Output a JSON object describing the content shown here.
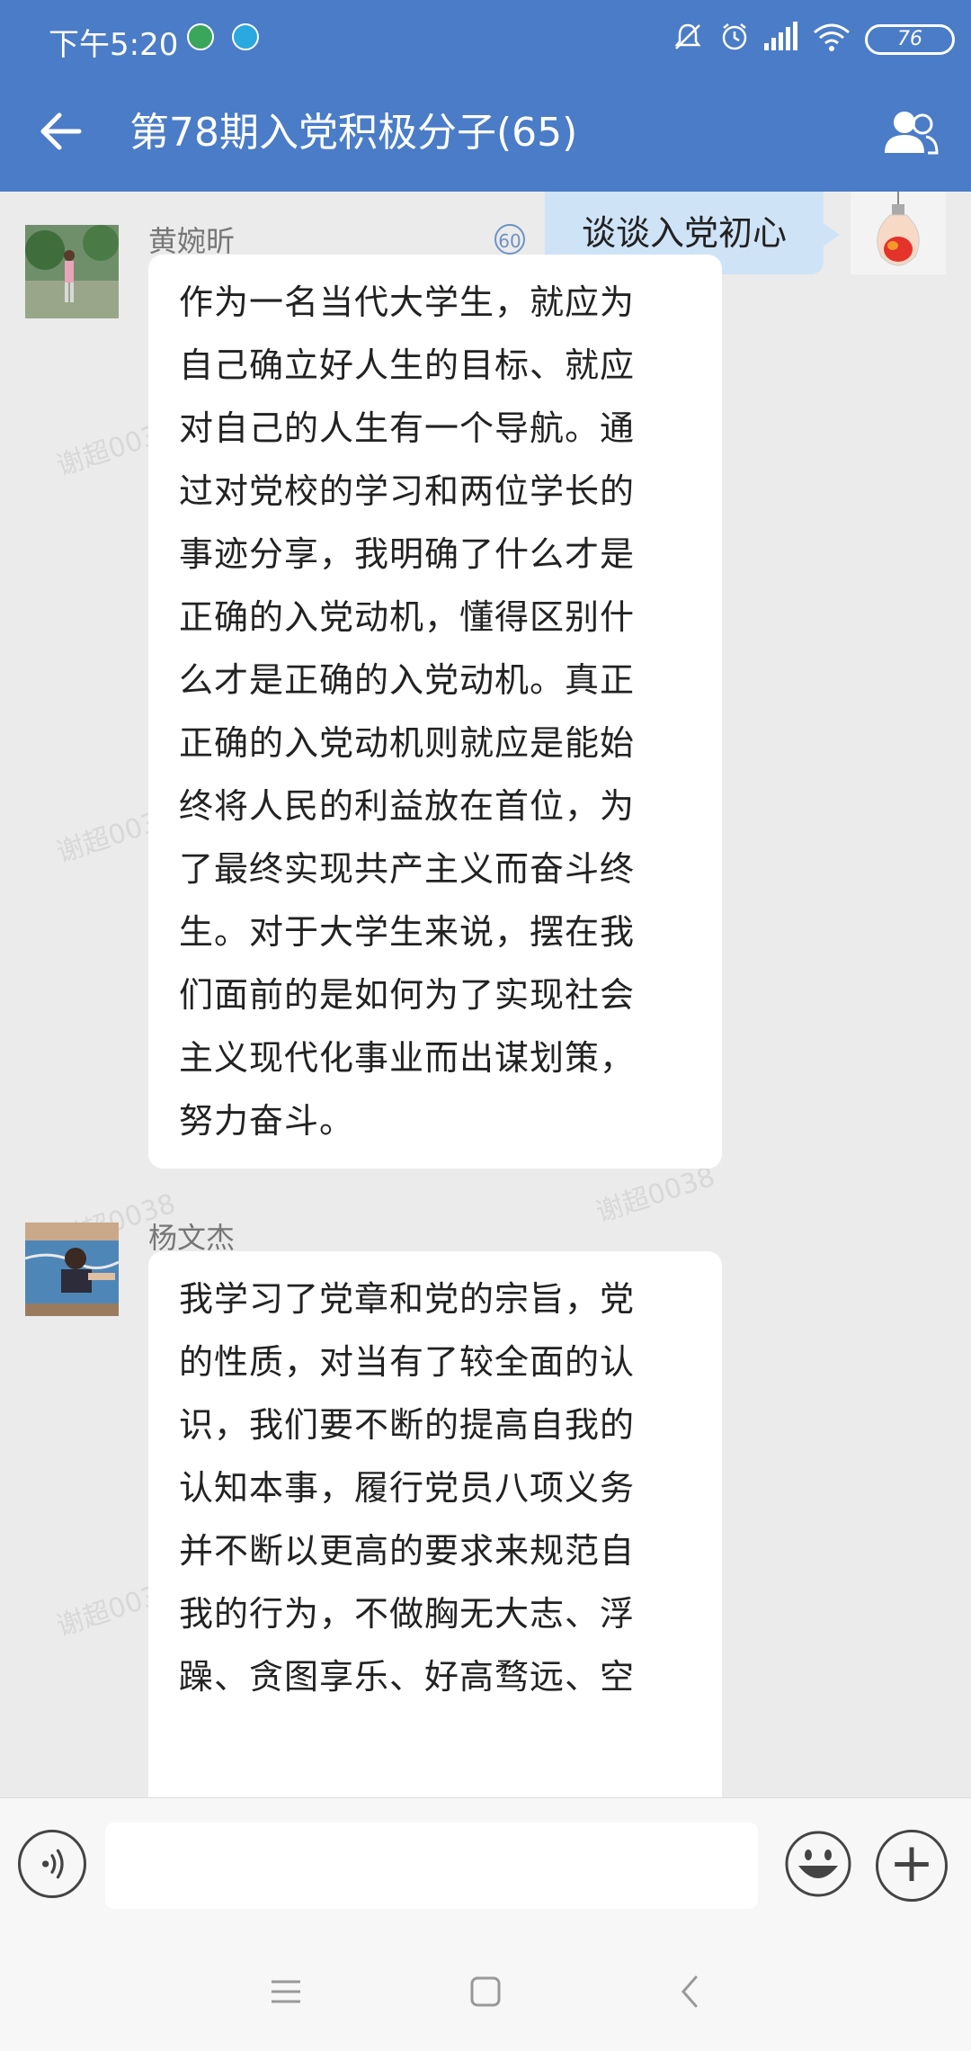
{
  "status_bar": {
    "time": "下午5:20",
    "battery": "76",
    "icons": [
      "app-notification-icon-1",
      "app-notification-icon-2",
      "mute-icon",
      "alarm-icon",
      "signal-icon",
      "wifi-icon",
      "battery-icon"
    ]
  },
  "header": {
    "title": "第78期入党积极分子(65)",
    "back_icon": "arrow-left-icon",
    "members_icon": "group-members-icon",
    "accent": "#4a7cc7"
  },
  "watermark": "谢超0038",
  "messages": [
    {
      "type": "self",
      "text": "谈谈入党初心",
      "read_count": "60"
    },
    {
      "type": "other",
      "sender": "黄婉昕",
      "lines": [
        "作为一名当代大学生，就应为",
        "自己确立好人生的目标、就应",
        "对自己的人生有一个导航。通",
        "过对党校的学习和两位学长的",
        "事迹分享，我明确了什么才是",
        "正确的入党动机，懂得区别什",
        "么才是正确的入党动机。真正",
        "正确的入党动机则就应是能始",
        "终将人民的利益放在首位，为",
        "了最终实现共产主义而奋斗终",
        "生。对于大学生来说，摆在我",
        "们面前的是如何为了实现社会",
        "主义现代化事业而出谋划策，",
        "努力奋斗。"
      ]
    },
    {
      "type": "other",
      "sender": "杨文杰",
      "lines": [
        "我学习了党章和党的宗旨，党",
        "的性质，对当有了较全面的认",
        "识，我们要不断的提高自我的",
        "认知本事，履行党员八项义务",
        "并不断以更高的要求来规范自",
        "我的行为，不做胸无大志、浮",
        "躁、贪图享乐、好高骛远、空"
      ]
    }
  ],
  "input_bar": {
    "voice_icon": "voice-input-icon",
    "emoji_icon": "emoji-icon",
    "plus_icon": "plus-icon",
    "plus_label": "+"
  },
  "nav_bar": {
    "icons": [
      "menu-icon",
      "home-icon",
      "back-icon"
    ]
  }
}
